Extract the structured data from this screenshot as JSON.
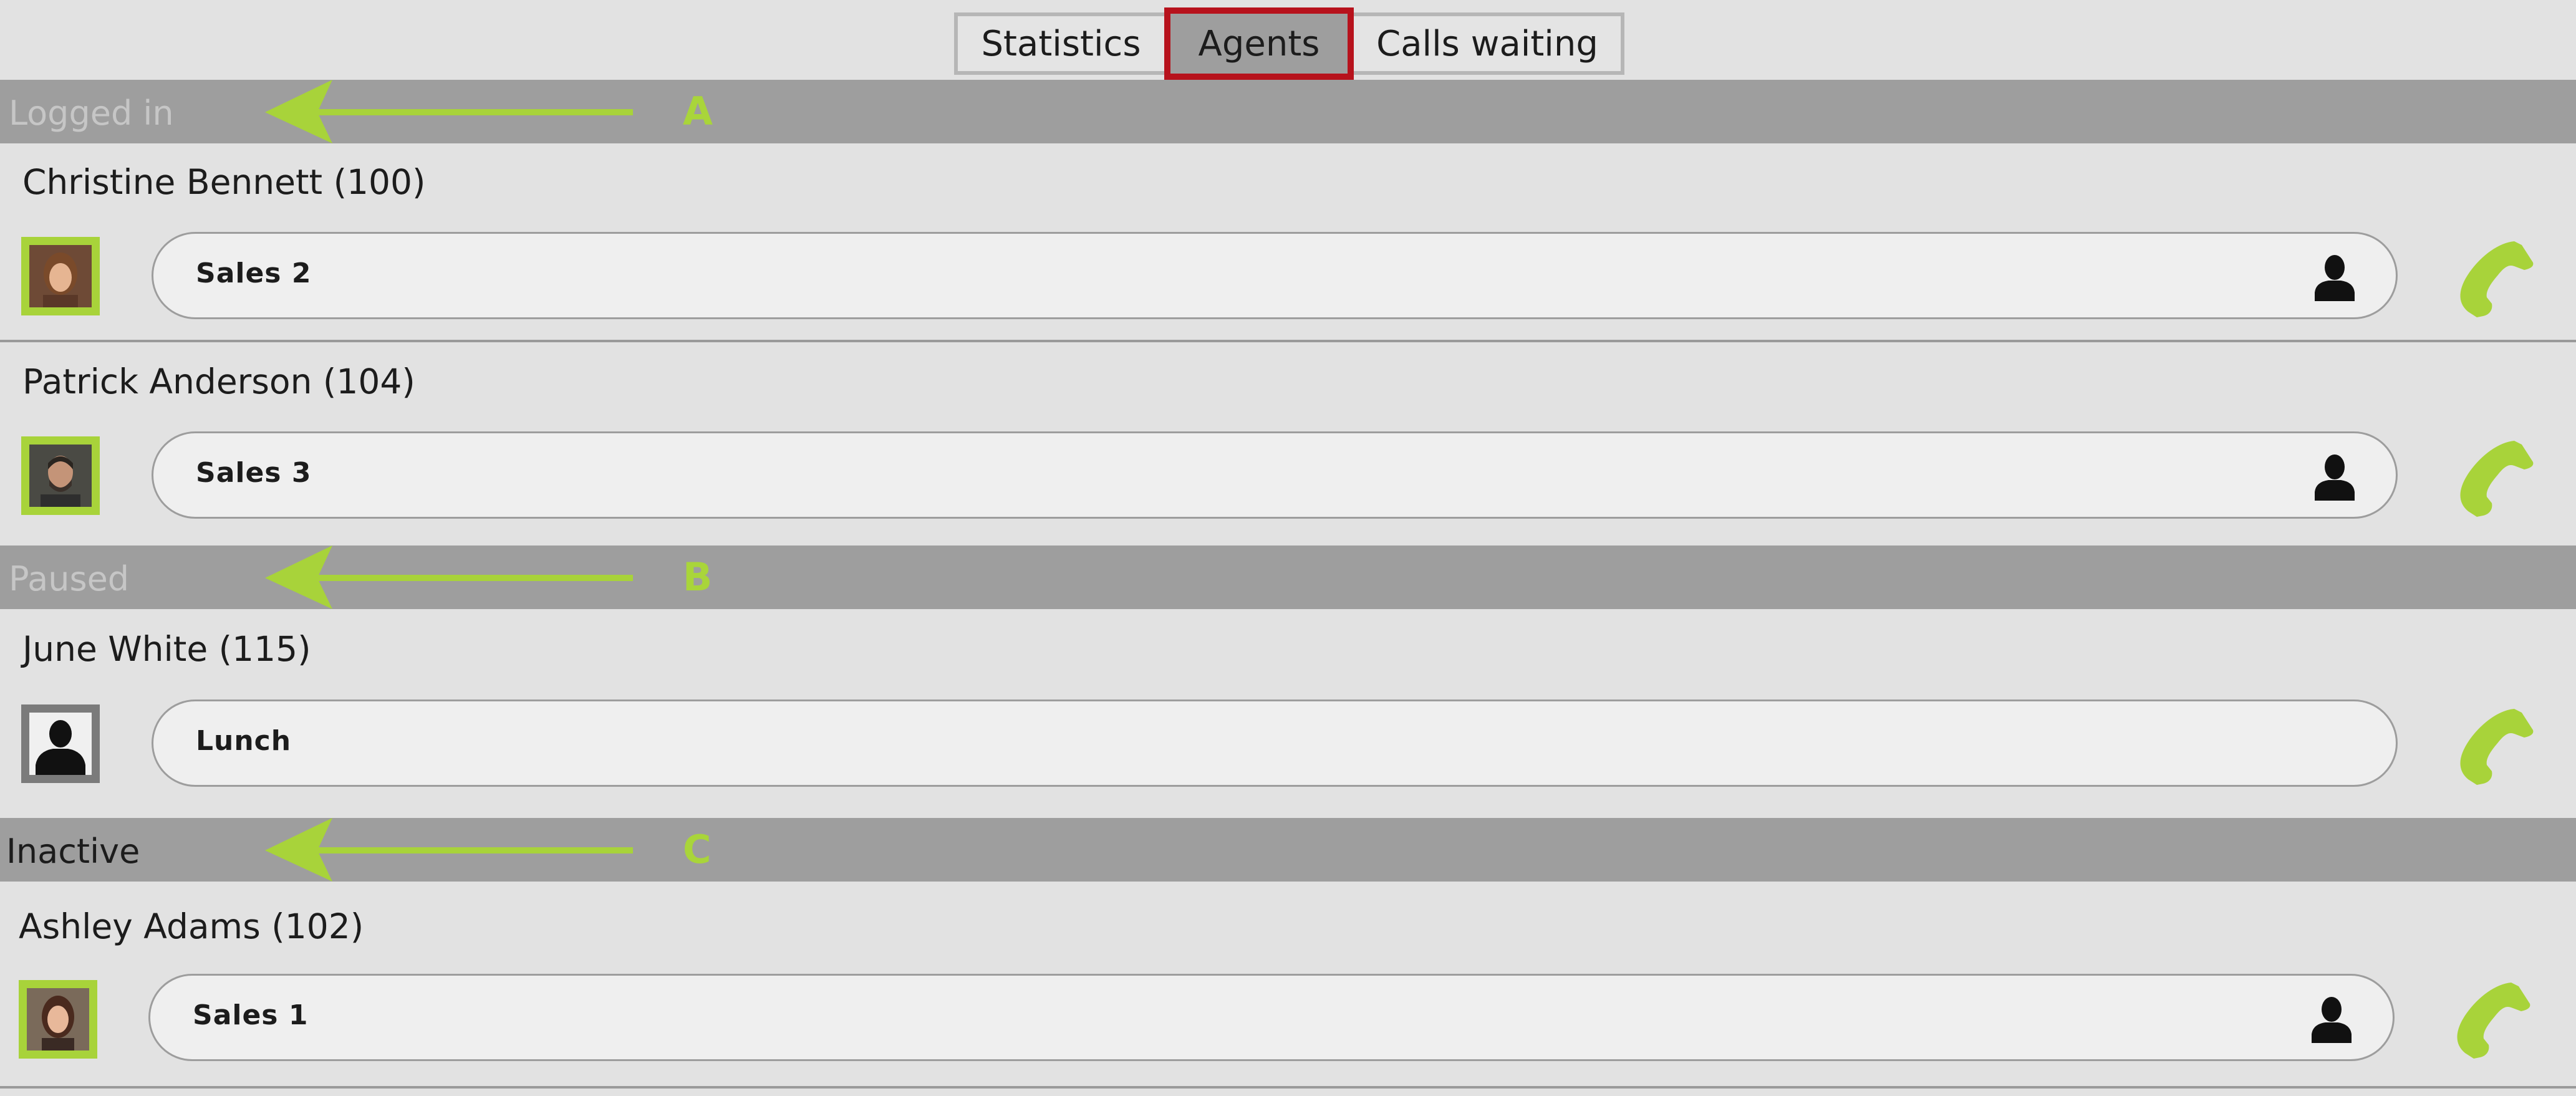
{
  "tabs": {
    "statistics": "Statistics",
    "agents": "Agents",
    "calls_waiting": "Calls waiting"
  },
  "sections": [
    {
      "title": "Logged in",
      "annotation": "A",
      "agents": [
        {
          "name": "Christine Bennett (100)",
          "status": "Sales 2",
          "avatar": "photo-woman-icon"
        },
        {
          "name": "Patrick Anderson (104)",
          "status": "Sales 3",
          "avatar": "photo-man-icon"
        }
      ]
    },
    {
      "title": "Paused",
      "annotation": "B",
      "agents": [
        {
          "name": "June White (115)",
          "status": "Lunch",
          "avatar": "default-user-icon"
        }
      ]
    },
    {
      "title": "Inactive",
      "annotation": "C",
      "agents": [
        {
          "name": "Ashley Adams (102)",
          "status": "Sales 1",
          "avatar": "photo-woman-icon"
        }
      ]
    }
  ],
  "colors": {
    "accent_green": "#a8d33a",
    "active_tab_border": "#b7121c",
    "section_bar": "#9e9e9e",
    "background": "#e2e2e2"
  }
}
